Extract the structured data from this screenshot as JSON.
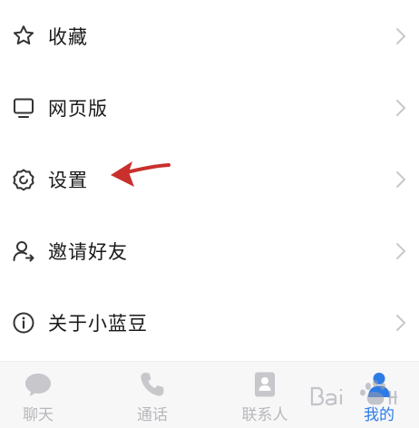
{
  "menu": {
    "items": [
      {
        "label": "收藏",
        "icon": "star-icon"
      },
      {
        "label": "网页版",
        "icon": "monitor-icon"
      },
      {
        "label": "设置",
        "icon": "gear-icon"
      },
      {
        "label": "邀请好友",
        "icon": "invite-user-icon"
      },
      {
        "label": "关于小蓝豆",
        "icon": "info-icon"
      }
    ]
  },
  "tabbar": {
    "tabs": [
      {
        "label": "聊天",
        "icon": "chat-bubble-icon",
        "active": false
      },
      {
        "label": "通话",
        "icon": "phone-icon",
        "active": false
      },
      {
        "label": "联系人",
        "icon": "contacts-book-icon",
        "active": false
      },
      {
        "label": "我的",
        "icon": "person-icon",
        "active": true
      }
    ]
  },
  "colors": {
    "text": "#1a1a1a",
    "chevron": "#c8c8cc",
    "tab_inactive": "#b8b8bc",
    "tab_active": "#2d7be6",
    "annotation_arrow": "#c9302c"
  }
}
